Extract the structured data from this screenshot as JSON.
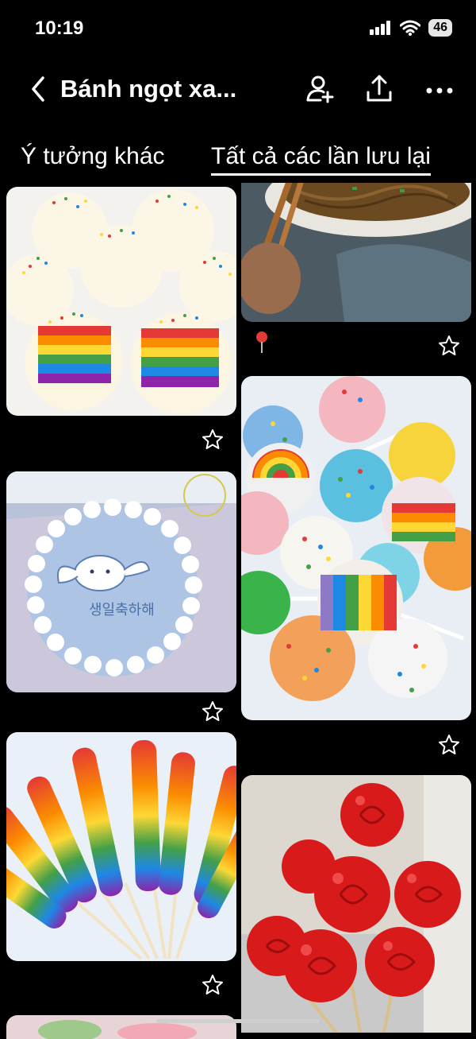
{
  "status_bar": {
    "time": "10:19",
    "battery": "46"
  },
  "header": {
    "title": "Bánh ngọt xa..."
  },
  "tabs": [
    {
      "label": "Ý tưởng khác",
      "active": false
    },
    {
      "label": "Tất cả các lần lưu lại",
      "active": true
    }
  ],
  "pins": [
    {
      "subject": "rainbow cake balls with sprinkles",
      "column": "left"
    },
    {
      "subject": "noodles with chopsticks",
      "column": "right"
    },
    {
      "subject": "blue cinnamoroll bento cake",
      "column": "left",
      "overlay_text": "생일축하해"
    },
    {
      "subject": "rainbow cake pops",
      "column": "right"
    },
    {
      "subject": "rainbow rock candy sticks",
      "column": "left"
    },
    {
      "subject": "red rose lollipops",
      "column": "right"
    }
  ],
  "icons": {
    "star": "star-outline-icon",
    "pin": "map-pin-icon"
  }
}
